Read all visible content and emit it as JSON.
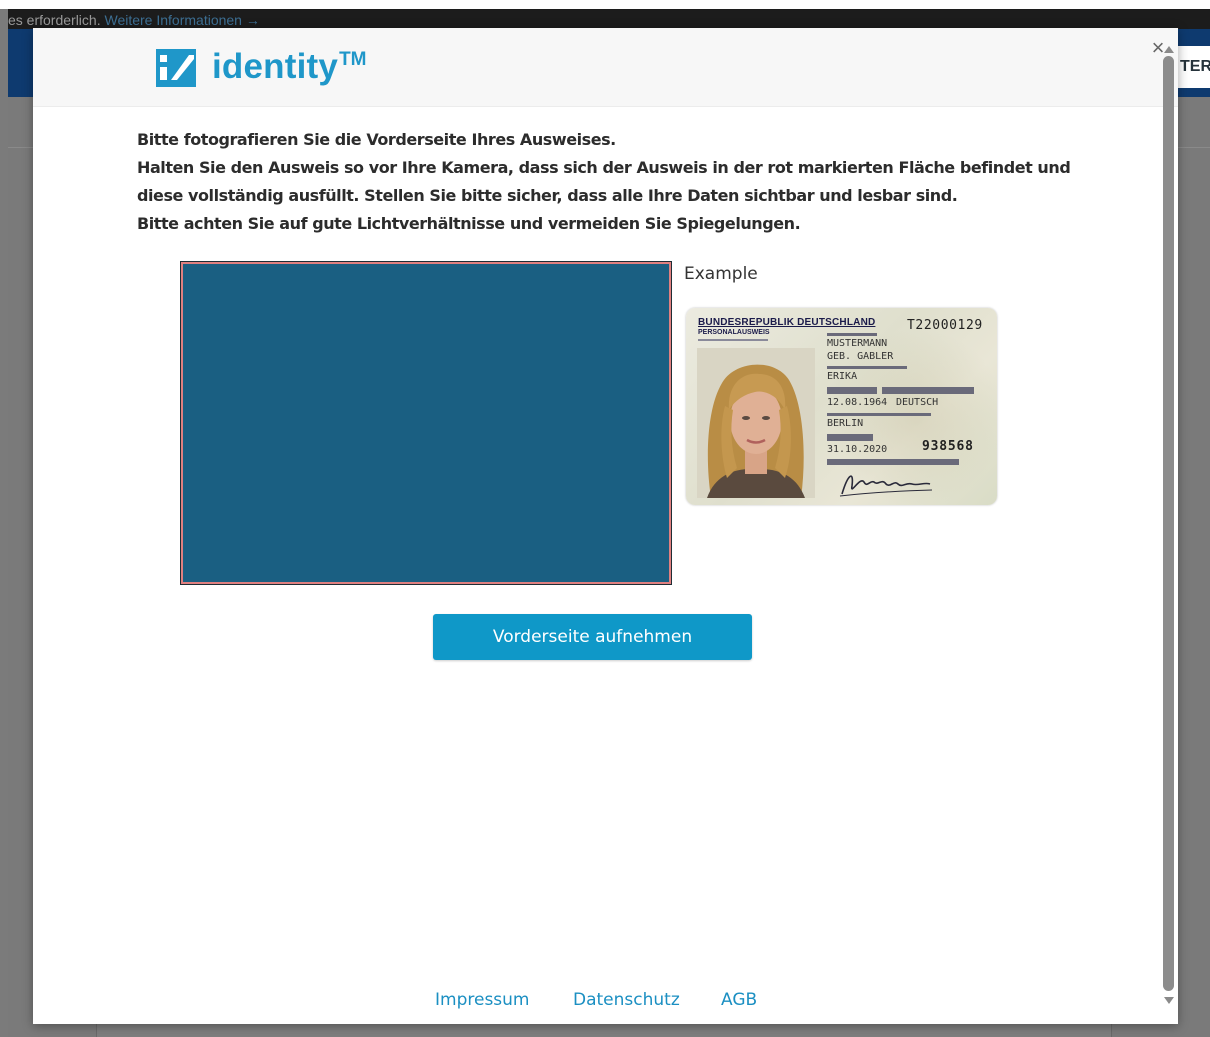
{
  "background": {
    "cookie_text": "es erforderlich. ",
    "cookie_link": "Weitere Informationen →",
    "nav_button_label": "TER"
  },
  "modal": {
    "logo_text": "identity",
    "logo_tm": "TM",
    "close_label": "×",
    "instructions": [
      "Bitte fotografieren Sie die Vorderseite Ihres Ausweises.",
      "Halten Sie den Ausweis so vor Ihre Kamera, dass sich der Ausweis in der rot markierten Fläche befindet und",
      "diese vollständig ausfüllt. Stellen Sie bitte sicher, dass alle Ihre Daten sichtbar und lesbar sind.",
      "Bitte achten Sie auf gute Lichtverhältnisse und vermeiden Sie Spiegelungen."
    ],
    "example_label": "Example",
    "example_card": {
      "header": "BUNDESREPUBLIK DEUTSCHLAND",
      "subheader": "PERSONALAUSWEIS",
      "document_number": "T22000129",
      "surname": "MUSTERMANN",
      "birth_name": "GEB. GABLER",
      "given_name": "ERIKA",
      "birth_date": "12.08.1964",
      "nationality": "DEUTSCH",
      "place_of_birth": "BERLIN",
      "expiry_date": "31.10.2020",
      "card_access_number": "938568"
    },
    "capture_button_label": "Vorderseite aufnehmen",
    "footer_links": [
      "Impressum",
      "Datenschutz",
      "AGB"
    ]
  },
  "colors": {
    "accent": "#0f98c8",
    "logo": "#1f97c9",
    "camera_frame_fill": "#1a5f82",
    "camera_frame_border": "#e08080",
    "navbar": "#0e3a6f"
  }
}
